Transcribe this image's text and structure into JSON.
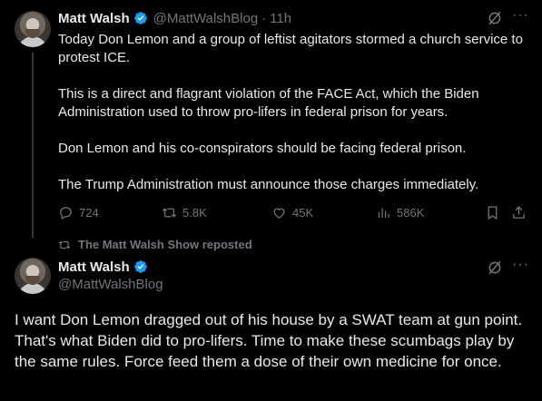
{
  "tweet1": {
    "author_name": "Matt Walsh",
    "handle": "@MattWalshBlog",
    "separator": "·",
    "time": "11h",
    "paragraphs": [
      "Today Don Lemon and a group of leftist agitators stormed a church service to protest ICE.",
      "This is a direct and flagrant violation of the FACE Act, which the Biden Administration used to throw pro-lifers in federal prison for years.",
      "Don Lemon and his co-conspirators should be facing federal prison.",
      "The Trump Administration must announce those charges immediately."
    ],
    "stats": {
      "replies": "724",
      "reposts": "5.8K",
      "likes": "45K",
      "views": "586K"
    }
  },
  "repost_banner": {
    "text": "The Matt Walsh Show reposted"
  },
  "tweet2": {
    "author_name": "Matt Walsh",
    "handle": "@MattWalshBlog",
    "text": "I want Don Lemon dragged out of his house by a SWAT team at gun point. That's what Biden did to pro-lifers. Time to make these scumbags play by the same rules. Force feed them a dose of their own medicine for once."
  },
  "icons": {
    "verified": "verified-badge-icon",
    "grok": "grok-icon",
    "more": "more-icon",
    "reply": "reply-icon",
    "repost": "repost-icon",
    "like": "like-icon",
    "views": "views-icon",
    "bookmark": "bookmark-icon",
    "share": "share-icon"
  },
  "colors": {
    "background": "#000000",
    "text": "#e7e9ea",
    "muted": "#71767b",
    "verified": "#1d9bf0"
  }
}
